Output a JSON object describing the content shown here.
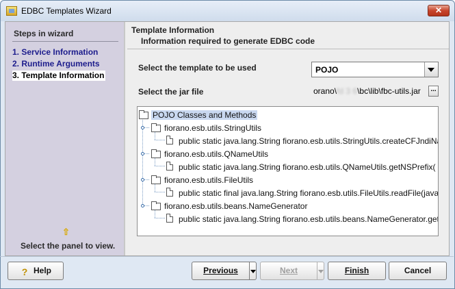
{
  "window": {
    "title": "EDBC Templates Wizard",
    "close_label": "✕"
  },
  "steps": {
    "title": "Steps in wizard",
    "items": [
      {
        "label": "1. Service Information"
      },
      {
        "label": "2. Runtime Arguments"
      },
      {
        "label": "3. Template Information"
      }
    ],
    "current_index": 2,
    "hint_icon": "arrow-up-icon",
    "hint": "Select the panel to view."
  },
  "header": {
    "title": "Template Information",
    "subtitle": "Information required to generate EDBC code"
  },
  "form": {
    "template_label": "Select the template to be used",
    "template_value": "POJO",
    "jar_label": "Select the jar file",
    "jar_prefix": "orano\\",
    "jar_redacted": "fd 3 6",
    "jar_suffix": "\\bc\\lib\\fbc-utils.jar",
    "browse_label": "..."
  },
  "tree": {
    "root": "POJO Classes and Methods",
    "classes": [
      {
        "name": "fiorano.esb.utils.StringUtils",
        "method": "public static java.lang.String fiorano.esb.utils.StringUtils.createCFJndiName("
      },
      {
        "name": "fiorano.esb.utils.QNameUtils",
        "method": "public static java.lang.String fiorano.esb.utils.QNameUtils.getNSPrefix("
      },
      {
        "name": "fiorano.esb.utils.FileUtils",
        "method": "public static final java.lang.String fiorano.esb.utils.FileUtils.readFile(java.io"
      },
      {
        "name": "fiorano.esb.utils.beans.NameGenerator",
        "method": "public static java.lang.String fiorano.esb.utils.beans.NameGenerator.getName("
      }
    ]
  },
  "buttons": {
    "help": "Help",
    "previous": "Previous",
    "next": "Next",
    "finish": "Finish",
    "cancel": "Cancel"
  },
  "colors": {
    "step_link": "#1c1c8c",
    "steps_panel": "#d4d0e0",
    "tree_selection": "#c9d8f0",
    "close_button": "#c7452c"
  }
}
